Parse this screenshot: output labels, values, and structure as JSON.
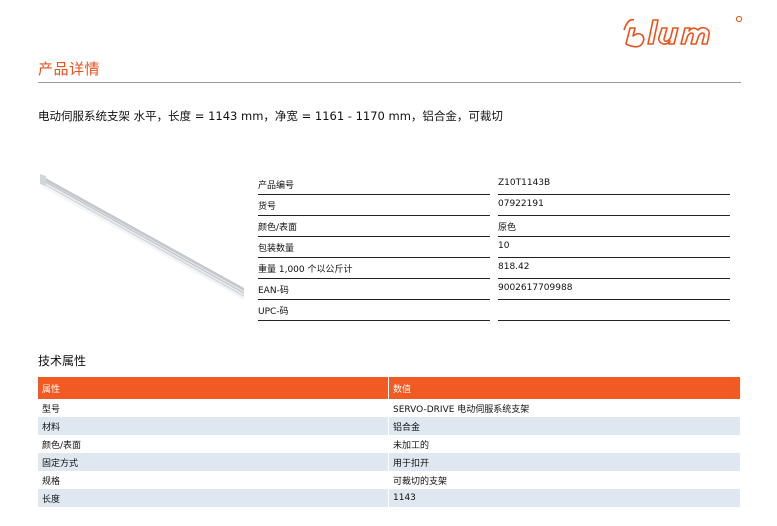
{
  "brand": {
    "logo_text": "blum",
    "accent_color": "#f15a22"
  },
  "page": {
    "title": "产品详情",
    "subtitle": "电动伺服系统支架 水平，长度 = 1143 mm，净宽 = 1161 - 1170 mm，铝合金，可裁切"
  },
  "specs": [
    {
      "label": "产品编号",
      "value": "Z10T1143B"
    },
    {
      "label": "货号",
      "value": "07922191"
    },
    {
      "label": "颜色/表面",
      "value": "原色"
    },
    {
      "label": "包装数量",
      "value": "10"
    },
    {
      "label": "重量 1,000 个以公斤计",
      "value": "818.42"
    },
    {
      "label": "EAN-码",
      "value": "9002617709988"
    },
    {
      "label": "UPC-码",
      "value": ""
    }
  ],
  "tech": {
    "title": "技术属性",
    "headers": [
      "属性",
      "数值"
    ],
    "rows": [
      [
        "型号",
        "SERVO-DRIVE 电动伺服系统支架"
      ],
      [
        "材料",
        "铝合金"
      ],
      [
        "颜色/表面",
        "未加工的"
      ],
      [
        "固定方式",
        "用于扣开"
      ],
      [
        "规格",
        "可裁切的支架"
      ],
      [
        "长度",
        "1143"
      ]
    ]
  }
}
